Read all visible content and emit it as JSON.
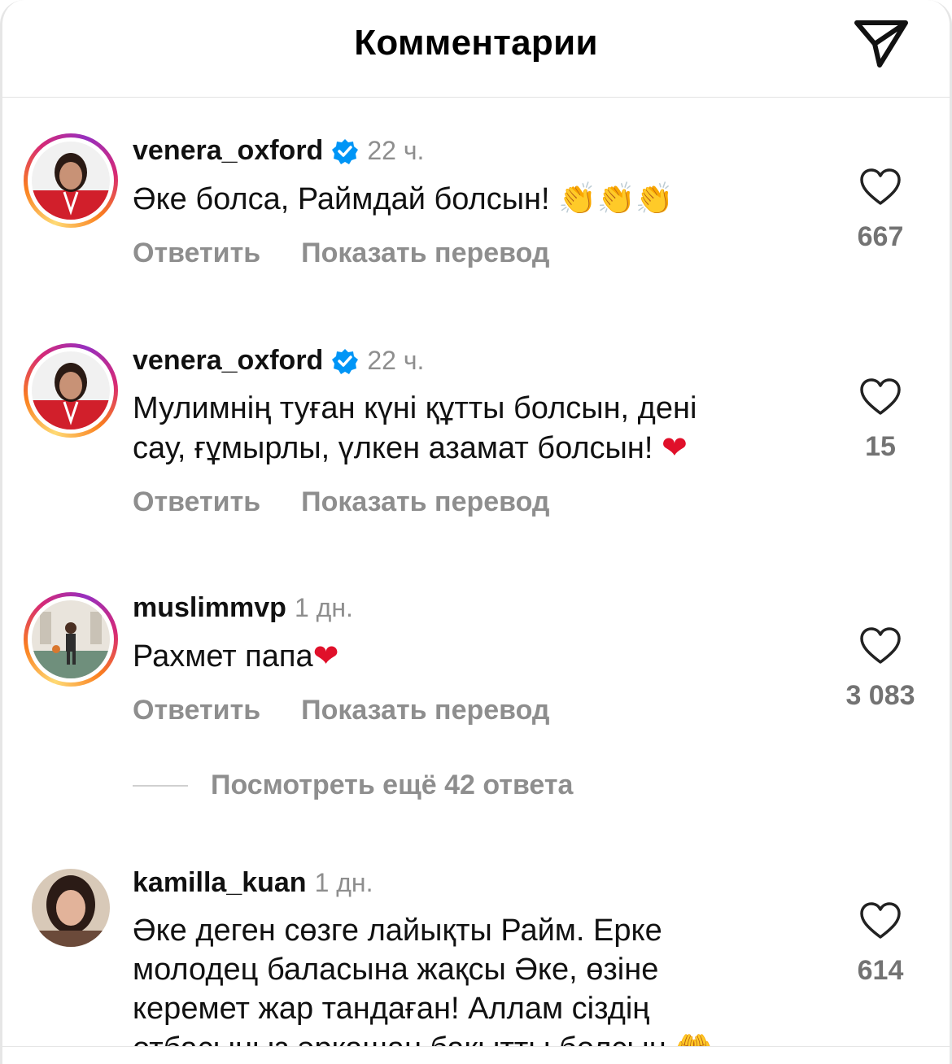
{
  "header": {
    "title": "Комментарии",
    "share_icon": "paper-plane-icon"
  },
  "comments": [
    {
      "username": "venera_oxford",
      "verified": true,
      "time": "22 ч.",
      "text_lines": [
        "Әке болса, Раймдай болсын!"
      ],
      "emojis": "👏👏👏",
      "reply": "Ответить",
      "translate": "Показать перевод",
      "likes": "667"
    },
    {
      "username": "venera_oxford",
      "verified": true,
      "time": "22 ч.",
      "text_lines": [
        "Мулимнің туған күні құтты болсын, дені",
        "сау, ғұмырлы, үлкен азамат болсын!"
      ],
      "emojis": "❤",
      "reply": "Ответить",
      "translate": "Показать перевод",
      "likes": "15"
    },
    {
      "username": "muslimmvp",
      "verified": false,
      "time": "1 дн.",
      "text_lines": [
        "Рахмет папа"
      ],
      "emojis": "❤",
      "reply": "Ответить",
      "translate": "Показать перевод",
      "likes": "3 083"
    },
    {
      "username": "kamilla_kuan",
      "verified": false,
      "time": "1 дн.",
      "text_lines": [
        "Әке деген сөзге лайықты Райм. Ерке",
        "молодец баласына жақсы Әке, өзіне",
        "керемет жар тандаған! Аллам сіздің",
        "отбасыңыз әрқашан бақытты болсын"
      ],
      "emojis": "🤲",
      "likes": "614"
    }
  ],
  "view_more": "Посмотреть ещё 42 ответа",
  "colors": {
    "accent_verified": "#0095f6",
    "heart_emoji": "#e0102a",
    "muted": "#8e8e8e"
  }
}
